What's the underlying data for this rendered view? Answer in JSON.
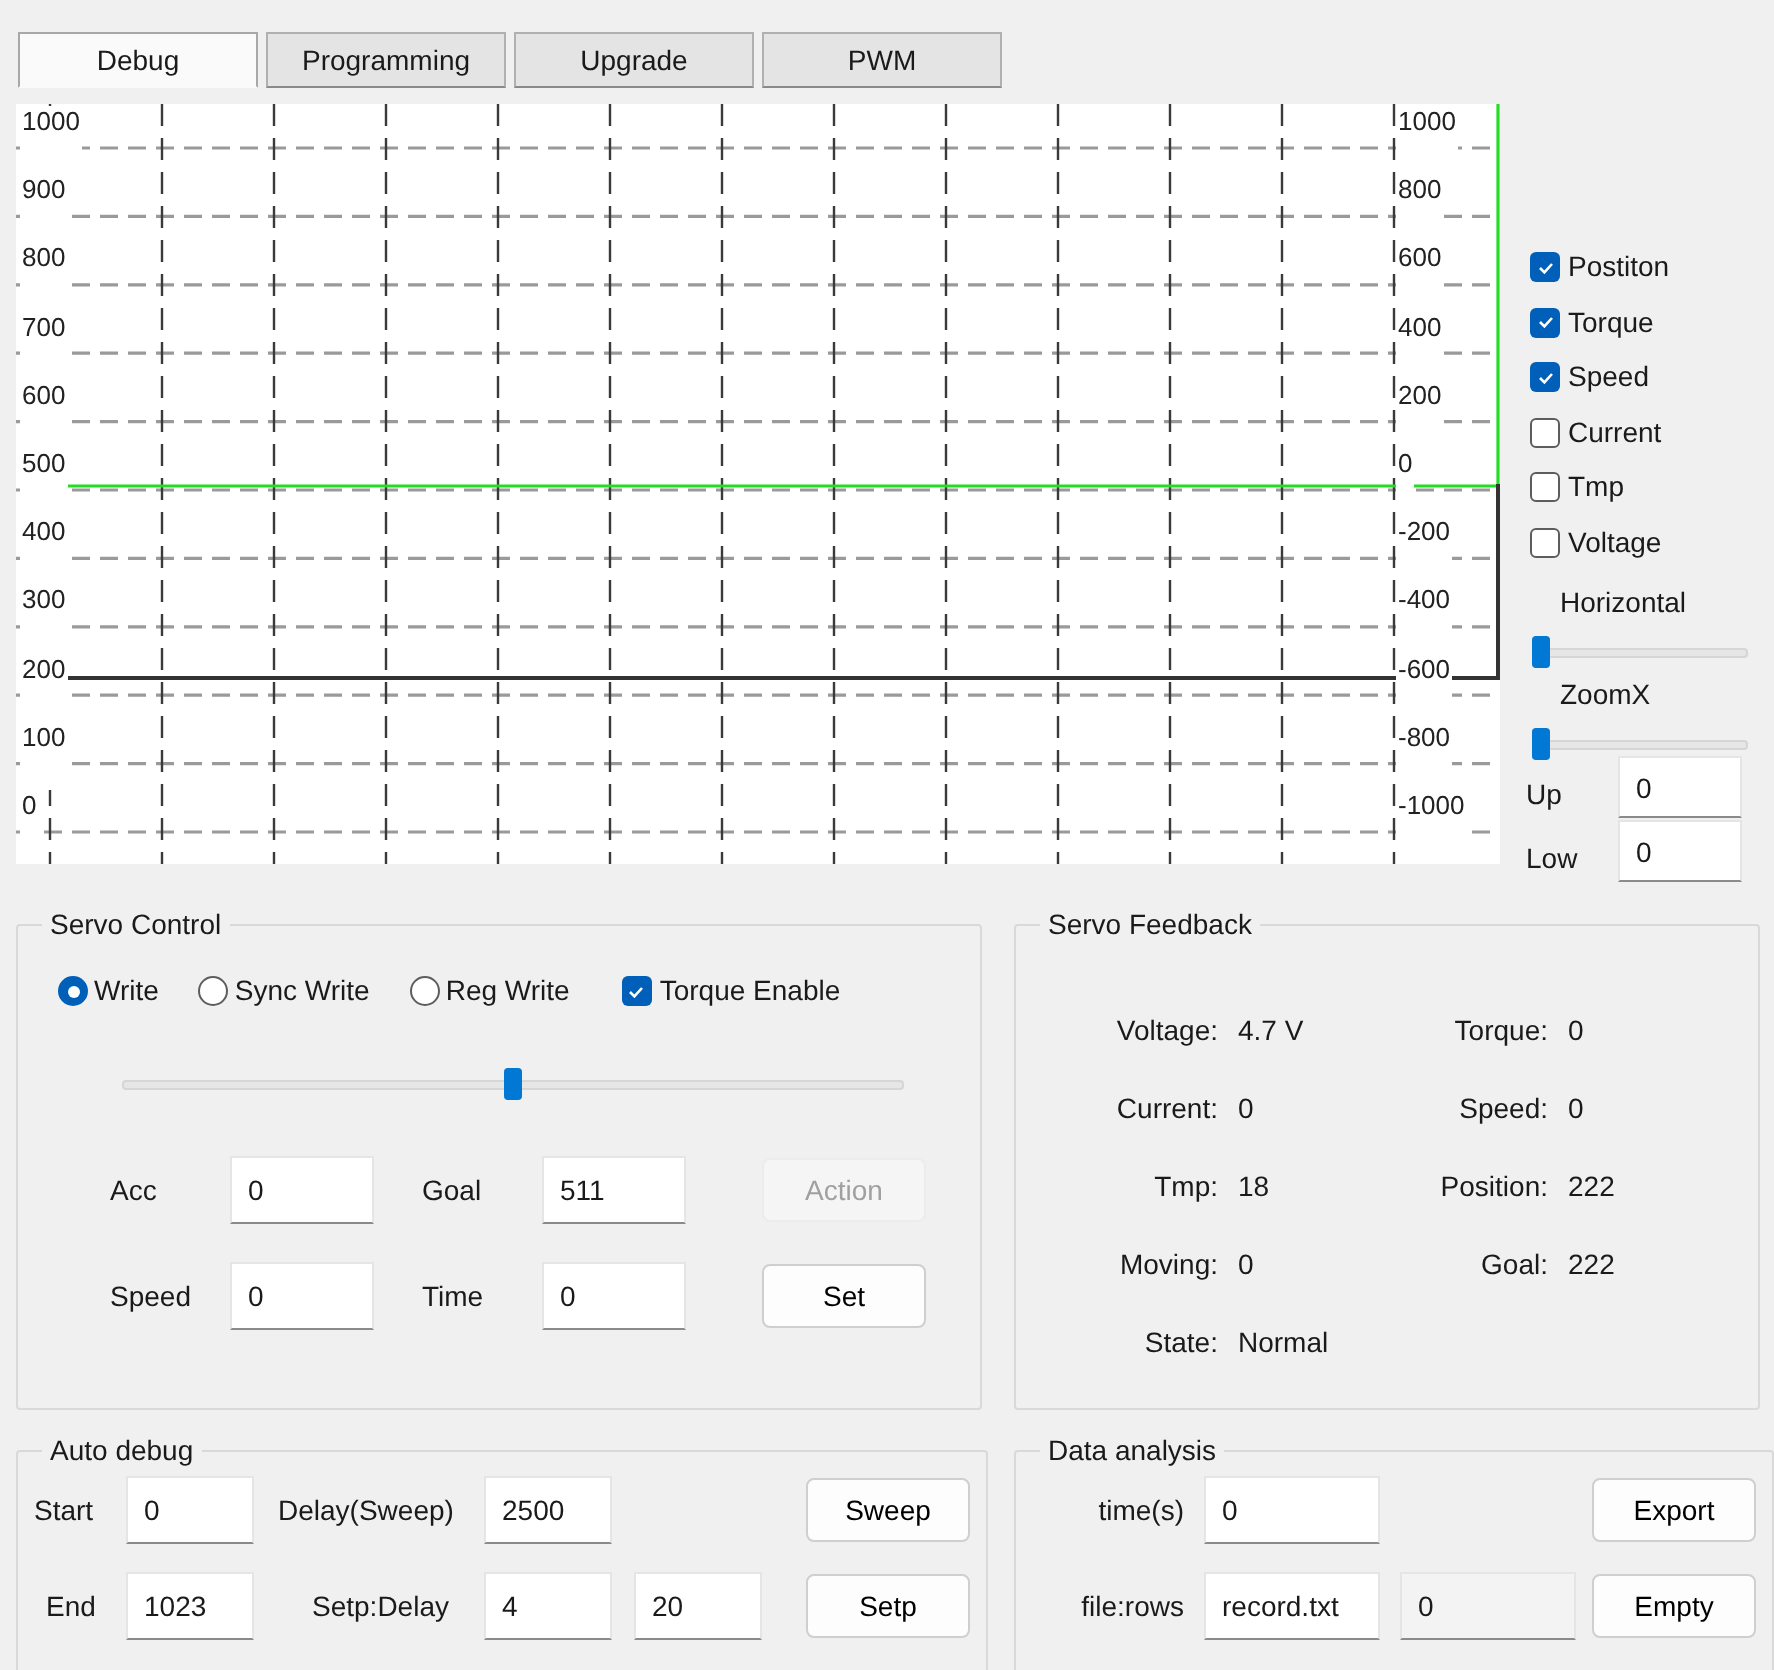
{
  "tabs": [
    {
      "label": "Debug",
      "selected": true
    },
    {
      "label": "Programming",
      "selected": false
    },
    {
      "label": "Upgrade",
      "selected": false
    },
    {
      "label": "PWM",
      "selected": false
    }
  ],
  "chart": {
    "left_ticks": [
      "1000",
      "900",
      "800",
      "700",
      "600",
      "500",
      "400",
      "300",
      "200",
      "100",
      "0"
    ],
    "right_ticks": [
      "1000",
      "800",
      "600",
      "400",
      "200",
      "0",
      "-200",
      "-400",
      "-600",
      "-800",
      "-1000"
    ]
  },
  "legend": [
    {
      "label": "Postiton",
      "checked": true
    },
    {
      "label": "Torque",
      "checked": true
    },
    {
      "label": "Speed",
      "checked": true
    },
    {
      "label": "Current",
      "checked": false
    },
    {
      "label": "Tmp",
      "checked": false
    },
    {
      "label": "Voltage",
      "checked": false
    }
  ],
  "sliders": [
    {
      "label": "Horizontal",
      "level": 0
    },
    {
      "label": "ZoomX",
      "level": 0
    }
  ],
  "range_fields": [
    {
      "label": "Up",
      "value": "0"
    },
    {
      "label": "Low",
      "value": "0"
    }
  ],
  "servo_control": {
    "title": "Servo Control",
    "modes": [
      {
        "label": "Write",
        "selected": true
      },
      {
        "label": "Sync Write",
        "selected": false
      },
      {
        "label": "Reg Write",
        "selected": false
      }
    ],
    "torque_enable": {
      "label": "Torque Enable",
      "checked": true
    },
    "slider": {
      "level": 0.5
    },
    "fields": [
      {
        "label": "Acc",
        "value": "0"
      },
      {
        "label": "Goal",
        "value": "511"
      },
      {
        "label": "Speed",
        "value": "0"
      },
      {
        "label": "Time",
        "value": "0"
      }
    ],
    "buttons": [
      {
        "label": "Action",
        "disabled": true
      },
      {
        "label": "Set",
        "disabled": false
      }
    ]
  },
  "servo_feedback": {
    "title": "Servo Feedback",
    "items": [
      {
        "label": "Voltage:",
        "value": "4.7 V"
      },
      {
        "label": "Torque:",
        "value": "0"
      },
      {
        "label": "Current:",
        "value": "0"
      },
      {
        "label": "Speed:",
        "value": "0"
      },
      {
        "label": "Tmp:",
        "value": "18"
      },
      {
        "label": "Position:",
        "value": "222"
      },
      {
        "label": "Moving:",
        "value": "0"
      },
      {
        "label": "Goal:",
        "value": "222"
      },
      {
        "label": "State:",
        "value": "Normal"
      }
    ]
  },
  "auto_debug": {
    "title": "Auto debug",
    "start": {
      "label": "Start",
      "value": "0"
    },
    "delay": {
      "label": "Delay(Sweep)",
      "value": "2500"
    },
    "sweep_button": "Sweep",
    "end": {
      "label": "End",
      "value": "1023"
    },
    "step": {
      "label": "Setp:Delay",
      "values": [
        "4",
        "20"
      ]
    },
    "step_button": "Setp"
  },
  "data_analysis": {
    "title": "Data analysis",
    "time": {
      "label": "time(s)",
      "value": "0"
    },
    "export_button": "Export",
    "file": {
      "label": "file:rows",
      "value": "record.txt",
      "rows": "0"
    },
    "empty_button": "Empty"
  }
}
